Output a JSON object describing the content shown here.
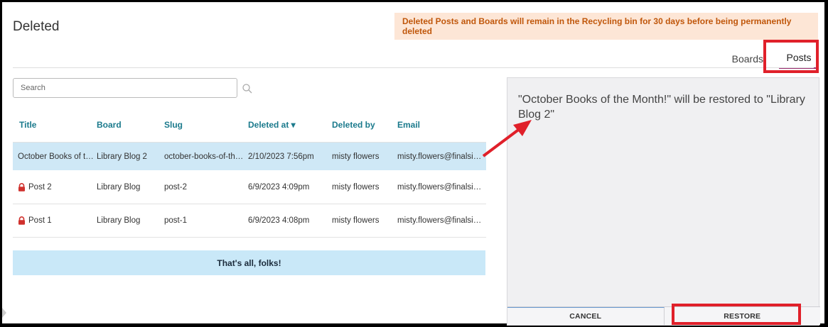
{
  "page": {
    "title": "Deleted"
  },
  "notice": {
    "text": "Deleted Posts and Boards will remain in the Recycling bin for 30 days before being permanently deleted"
  },
  "tabs": {
    "boards": "Boards",
    "posts": "Posts"
  },
  "search": {
    "placeholder": "Search"
  },
  "table": {
    "headers": {
      "title": "Title",
      "board": "Board",
      "slug": "Slug",
      "deleted_at": "Deleted at ▾",
      "deleted_by": "Deleted by",
      "email": "Email"
    },
    "rows": [
      {
        "title": "October Books of the Month!",
        "board": "Library Blog 2",
        "slug": "october-books-of-the-month",
        "deleted_at": "2/10/2023 7:56pm",
        "deleted_by": "misty flowers",
        "email": "misty.flowers@finalsite.com",
        "locked": false
      },
      {
        "title": "Post 2",
        "board": "Library Blog",
        "slug": "post-2",
        "deleted_at": "6/9/2023 4:09pm",
        "deleted_by": "misty flowers",
        "email": "misty.flowers@finalsite.com",
        "locked": true
      },
      {
        "title": "Post 1",
        "board": "Library Blog",
        "slug": "post-1",
        "deleted_at": "6/9/2023 4:08pm",
        "deleted_by": "misty flowers",
        "email": "misty.flowers@finalsite.com",
        "locked": true
      }
    ]
  },
  "footer": {
    "text": "That's all, folks!"
  },
  "panel": {
    "message": "\"October Books of the Month!\" will be restored to \"Library Blog 2\"",
    "cancel": "CANCEL",
    "restore": "RESTORE"
  },
  "colors": {
    "accent": "#1b7a8c",
    "highlight": "#e0202a",
    "selected_row": "#cfe8f6",
    "notice_bg": "#fde6d6",
    "notice_text": "#c0570b"
  }
}
